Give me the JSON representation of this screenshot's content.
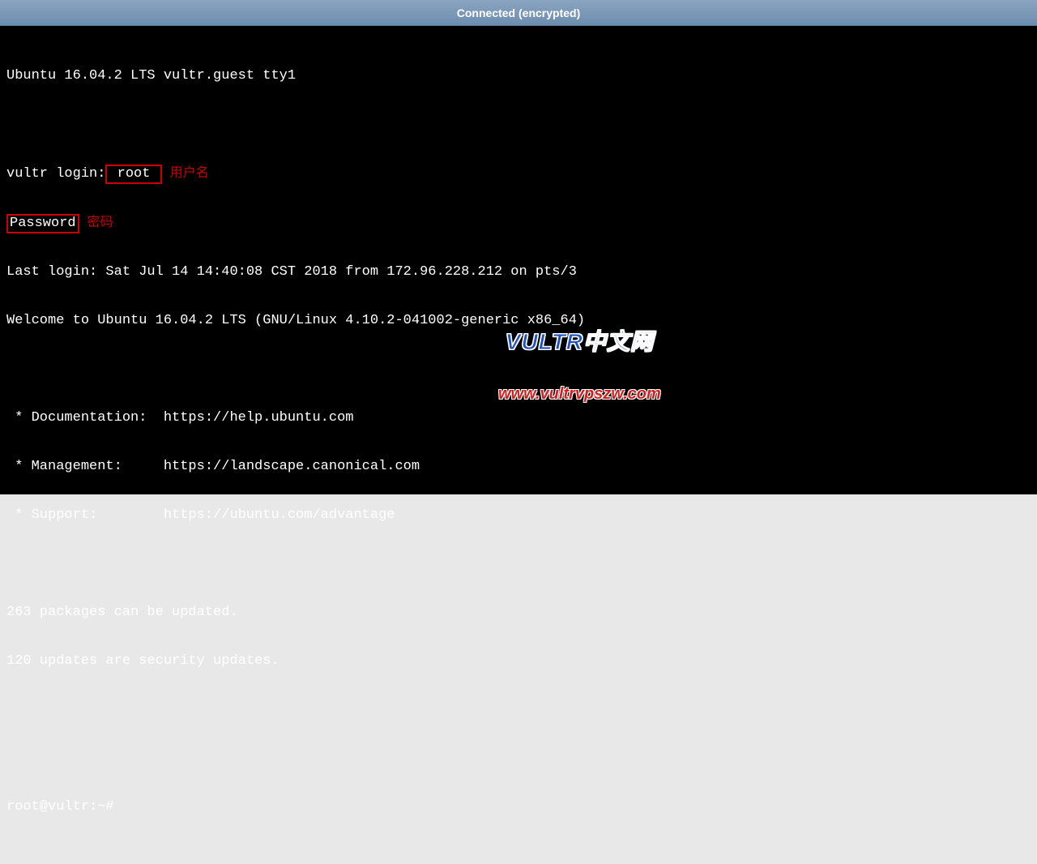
{
  "titlebar": {
    "text": "Connected (encrypted)"
  },
  "terminal": {
    "banner": "Ubuntu 16.04.2 LTS vultr.guest tty1",
    "login_prompt_prefix": "vultr login:",
    "login_user": " root ",
    "login_annotation": "用户名",
    "password_prompt": "Password",
    "password_annotation": "密码",
    "last_login": "Last login: Sat Jul 14 14:40:08 CST 2018 from 172.96.228.212 on pts/3",
    "welcome": "Welcome to Ubuntu 16.04.2 LTS (GNU/Linux 4.10.2-041002-generic x86_64)",
    "docs_line": " * Documentation:  https://help.ubuntu.com",
    "mgmt_line": " * Management:     https://landscape.canonical.com",
    "support_line": " * Support:        https://ubuntu.com/advantage",
    "packages_line": "263 packages can be updated.",
    "security_line": "120 updates are security updates.",
    "prompt": "root@vultr:~#"
  },
  "watermark": {
    "title": "VULTR中文网",
    "url": "www.vultrvpszw.com"
  }
}
